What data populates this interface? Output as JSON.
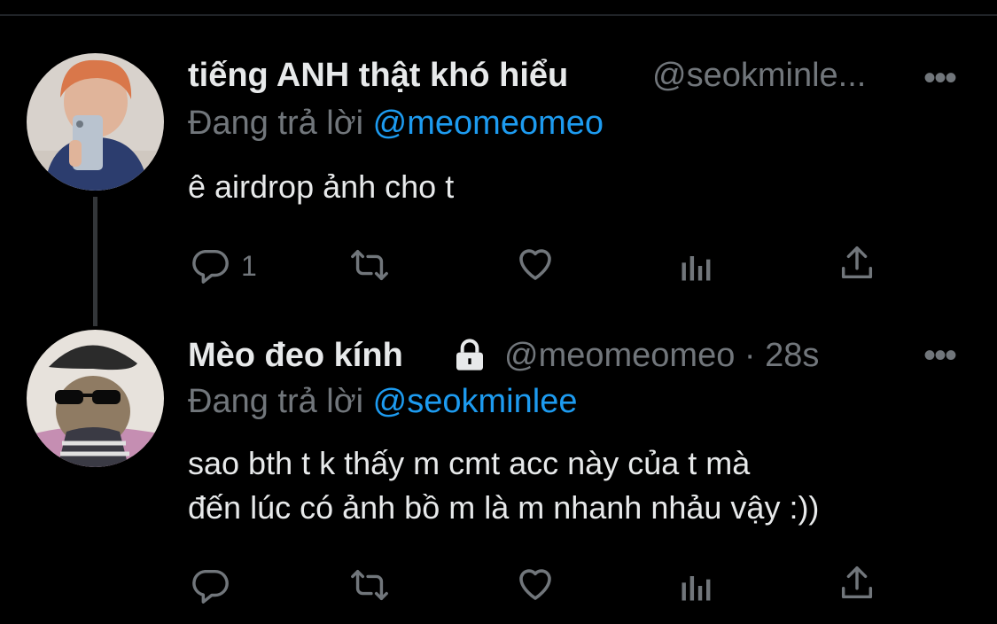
{
  "tweets": [
    {
      "display_name": "tiếng ANH thật khó hiểu",
      "handle": "@seokminle...",
      "reply_prefix": "Đang trả lời ",
      "reply_to": "@meomeomeo",
      "text": "ê airdrop ảnh cho t",
      "reply_count": "1",
      "more_label": "•••"
    },
    {
      "display_name": "Mèo đeo kính",
      "handle": "@meomeomeo · 28s",
      "reply_prefix": "Đang trả lời ",
      "reply_to": "@seokminlee",
      "text_line1": "sao bth t k thấy m cmt acc này của t mà",
      "text_line2": "đến lúc có ảnh bồ m là m nhanh nhảu vậy :))",
      "more_label": "•••"
    }
  ],
  "colors": {
    "background": "#000000",
    "text": "#e7e9ea",
    "secondary": "#71767b",
    "mention": "#1d9bf0"
  },
  "icons": [
    "reply-icon",
    "retweet-icon",
    "like-icon",
    "analytics-icon",
    "share-icon",
    "lock-icon",
    "more-icon"
  ]
}
